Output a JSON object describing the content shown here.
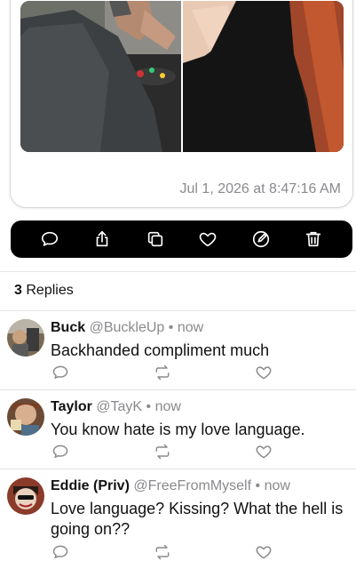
{
  "post": {
    "timestamp": "Jul 1, 2026 at 8:47:16 AM"
  },
  "action_bar": {
    "icons": [
      "comment-icon",
      "share-icon",
      "copy-icon",
      "heart-icon",
      "edit-icon",
      "trash-icon"
    ]
  },
  "replies_header": {
    "count": "3",
    "label": "Replies"
  },
  "replies": [
    {
      "name": "Buck",
      "handle": "@BuckleUp",
      "dot": "•",
      "time": "now",
      "text": "Backhanded compliment much"
    },
    {
      "name": "Taylor",
      "handle": "@TayK",
      "dot": "•",
      "time": "now",
      "text": "You know hate is my love language."
    },
    {
      "name": "Eddie (Priv)",
      "handle": "@FreeFromMyself",
      "dot": "•",
      "time": "now",
      "text": "Love language? Kissing? What the hell is going on??"
    }
  ],
  "colors": {
    "action_bar_bg": "#000000",
    "secondary_text": "#8a8a8e",
    "icon_gray": "#8a8a8e"
  }
}
